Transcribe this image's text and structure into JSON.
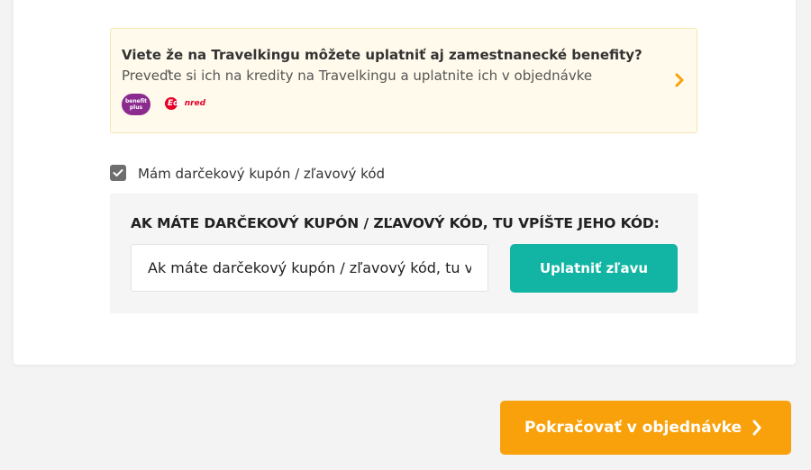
{
  "benefits": {
    "title": "Viete že na Travelkingu môžete uplatniť aj zamestnanecké benefity?",
    "subtitle": "Preveďte si ich na kredity na Travelkingu a uplatnite ich v objednávke",
    "logos": [
      "benefit-plus-logo",
      "edenred-logo"
    ],
    "benefit_plus_text": "benefit plus",
    "accent_color": "#f9a10a"
  },
  "coupon": {
    "checkbox_label": "Mám darčekový kupón / zľavový kód",
    "checked": true,
    "heading": "AK MÁTE DARČEKOVÝ KUPÓN / ZĽAVOVÝ KÓD, TU VPÍŠTE JEHO KÓD:",
    "input_placeholder": "Ak máte darčekový kupón / zľavový kód, tu vpíšte jeho kód",
    "input_value": "",
    "apply_label": "Uplatniť zľavu",
    "apply_color": "#12b5a3"
  },
  "footer": {
    "continue_label": "Pokračovať v objednávke",
    "continue_color": "#f9a10a"
  }
}
